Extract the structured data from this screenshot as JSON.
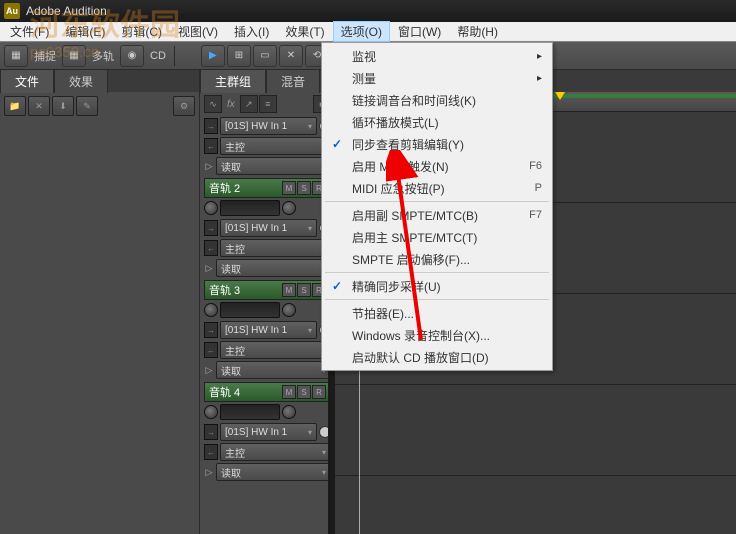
{
  "title": "Adobe Audition",
  "menus": [
    {
      "label": "文件(F)"
    },
    {
      "label": "编辑(E)"
    },
    {
      "label": "剪辑(C)"
    },
    {
      "label": "视图(V)"
    },
    {
      "label": "插入(I)"
    },
    {
      "label": "效果(T)"
    },
    {
      "label": "选项(O)"
    },
    {
      "label": "窗口(W)"
    },
    {
      "label": "帮助(H)"
    }
  ],
  "toolbar": {
    "capture": "捕捉",
    "multitrack": "多轨",
    "cd": "CD"
  },
  "left_panel": {
    "tab_files": "文件",
    "tab_effects": "效果"
  },
  "center_panel": {
    "tab_main": "主群组",
    "tab_mix": "混音"
  },
  "tracks": [
    {
      "name": "",
      "hw": "[01S] HW In 1",
      "master": "主控",
      "read": "读取"
    },
    {
      "name": "音轨 2",
      "hw": "[01S] HW In 1",
      "master": "主控",
      "read": "读取"
    },
    {
      "name": "音轨 3",
      "hw": "[01S] HW In 1",
      "master": "主控",
      "read": "读取"
    },
    {
      "name": "音轨 4",
      "hw": "[01S] HW In 1",
      "master": "主控",
      "read": "读取"
    }
  ],
  "dropdown": {
    "items": [
      {
        "label": "监视",
        "submenu": true
      },
      {
        "label": "测量",
        "submenu": true
      },
      {
        "label": "链接调音台和时间线(K)"
      },
      {
        "label": "循环播放模式(L)"
      },
      {
        "label": "同步查看剪辑编辑(Y)",
        "checked": true
      },
      {
        "label": "启用 MIDI 触发(N)",
        "shortcut": "F6"
      },
      {
        "label": "MIDI 应急按钮(P)",
        "shortcut": "P"
      },
      {
        "sep": true
      },
      {
        "label": "启用副 SMPTE/MTC(B)",
        "shortcut": "F7"
      },
      {
        "label": "启用主 SMPTE/MTC(T)"
      },
      {
        "label": "SMPTE 启动偏移(F)..."
      },
      {
        "sep": true
      },
      {
        "label": "精确同步采样(U)",
        "checked": true
      },
      {
        "sep": true
      },
      {
        "label": "节拍器(E)..."
      },
      {
        "label": "Windows 录音控制台(X)..."
      },
      {
        "label": "启动默认 CD 播放窗口(D)"
      }
    ]
  },
  "watermark": {
    "main": "河东软件园",
    "sub": "pc0359.cn"
  }
}
